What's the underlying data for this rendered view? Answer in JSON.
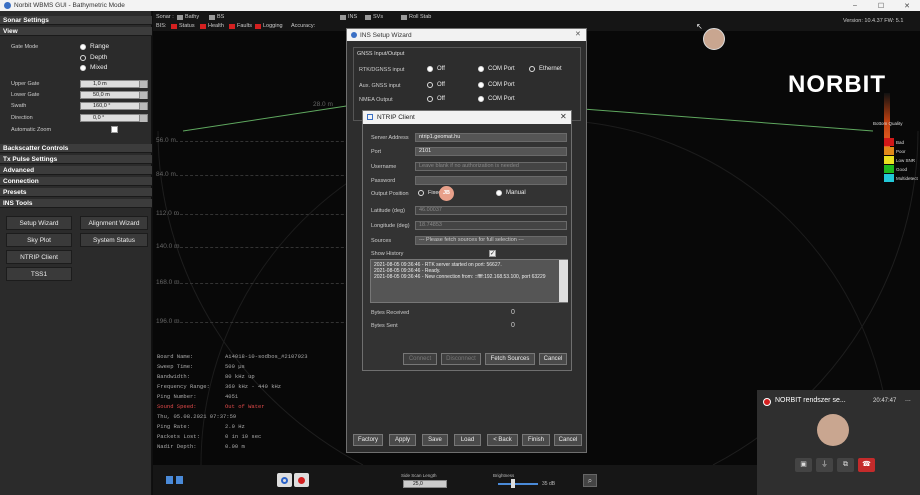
{
  "window": {
    "title": "Norbit WBMS GUI - Bathymetric Mode",
    "controls": [
      "–",
      "☐",
      "✕"
    ]
  },
  "sidebar": {
    "sections": {
      "sonar_settings": "Sonar Settings",
      "view": "View",
      "backscatter": "Backscatter Controls",
      "tx_pulse": "Tx Pulse Settings",
      "advanced": "Advanced",
      "connection": "Connection",
      "presets": "Presets",
      "ins_tools": "INS Tools"
    },
    "view": {
      "gate_mode_label": "Gate Mode",
      "gate_mode_options": [
        "Range",
        "Depth",
        "Mixed"
      ],
      "upper_gate_label": "Upper Gate",
      "upper_gate_value": "1,0 m",
      "lower_gate_label": "Lower Gate",
      "lower_gate_value": "50,0 m",
      "swath_label": "Swath",
      "swath_value": "160,0 °",
      "direction_label": "Direction",
      "direction_value": "0,0 °",
      "auto_zoom_label": "Automatic Zoom"
    },
    "ins_tools": {
      "setup_wizard": "Setup Wizard",
      "alignment_wizard": "Alignment Wizard",
      "sky_plot": "Sky Plot",
      "system_status": "System Status",
      "ntrip_client": "NTRIP Client",
      "tss1": "TSS1"
    }
  },
  "toolbar": {
    "sonar_label": "Sonar :",
    "bathy": "Bathy",
    "bs": "BS",
    "bis_label": "BIS:",
    "status": "Status",
    "health": "Health",
    "faults": "Faults",
    "logging": "Logging",
    "accuracy": "Accuracy:",
    "ins": "INS",
    "svs": "SVs",
    "roll_stab": "Roll Stab",
    "version": "Version: 10.4.37  FW: 5.1",
    "status_colors": {
      "red": "#d42020",
      "gray": "#9a9a9a"
    }
  },
  "main": {
    "depth_labels": [
      "56.0 m",
      "84.0 m",
      "112.0 m",
      "140.0 m",
      "168.0 m",
      "196.0 m"
    ],
    "marker_label": "28.0 m",
    "brand": "NORBIT",
    "legend_title": "Bottom Quality",
    "legend": [
      {
        "label": "Bad",
        "color": "#d01818"
      },
      {
        "label": "Poor",
        "color": "#e08a1a"
      },
      {
        "label": "Low SNR",
        "color": "#e8e020"
      },
      {
        "label": "Good",
        "color": "#1fb81f"
      },
      {
        "label": "Multidetect",
        "color": "#22c8d8"
      }
    ],
    "info": [
      {
        "k": "Board Name:",
        "v": "Ai4018-10-sodbos_#2107023",
        "color": "#aaaaaa"
      },
      {
        "k": "Sweep Time:",
        "v": "500 µs",
        "color": "#aaaaaa"
      },
      {
        "k": "Bandwidth:",
        "v": "80 kHz up",
        "color": "#aaaaaa"
      },
      {
        "k": "Frequency Range:",
        "v": "360 kHz - 440 kHz",
        "color": "#aaaaaa"
      },
      {
        "k": "Ping Number:",
        "v": "4051",
        "color": "#aaaaaa"
      },
      {
        "k": "Sound Speed:",
        "v": "Out of Water",
        "color": "#e34a4a"
      },
      {
        "k": "Thu, 05.08.2021 07:37:59",
        "v": "",
        "color": "#aaaaaa"
      },
      {
        "k": "Ping Rate:",
        "v": "2.0 Hz",
        "color": "#aaaaaa"
      },
      {
        "k": "Packets Lost:",
        "v": "0 in 10 sec",
        "color": "#aaaaaa"
      },
      {
        "k": "Nadir Depth:",
        "v": "0.00 m",
        "color": "#aaaaaa"
      }
    ]
  },
  "bottombar": {
    "side_scan_label": "Side Scan Length",
    "side_scan_value": "25,0",
    "brightness_label": "Brightness",
    "brightness_value": "35 dB"
  },
  "ins_wizard": {
    "title": "INS Setup Wizard",
    "group": "GNSS Input/Output",
    "rtk_label": "RTK/DGNSS input",
    "aux_label": "Aux. GNSS input",
    "nmea_label": "NMEA Output",
    "off": "Off",
    "com_port": "COM Port",
    "ethernet": "Ethernet",
    "buttons": {
      "factory": "Factory",
      "apply": "Apply",
      "save": "Save",
      "load": "Load",
      "back": "< Back",
      "finish": "Finish",
      "cancel": "Cancel"
    }
  },
  "ntrip": {
    "title": "NTRIP Client",
    "server_address_label": "Server Address",
    "server_address": "ntrip1.geomat.hu",
    "port_label": "Port",
    "port": "2101",
    "username_label": "Username",
    "username_placeholder": "Leave blank if no authorization is needed",
    "password_label": "Password",
    "output_position_label": "Output Position",
    "fixed": "Fixed",
    "manual": "Manual",
    "latitude_label": "Latitude (deg)",
    "latitude": "46.00037",
    "longitude_label": "Longitude (deg)",
    "longitude": "18.74853",
    "sources_label": "Sources",
    "sources_placeholder": "--- Please fetch sources for full selection ---",
    "show_history_label": "Show History",
    "history": [
      "2021-08-05 09:36:46 - RTK server started on port: 56627.",
      "2021-08-05 09:36:46 - Ready.",
      "2021-08-05 09:36:46 - New connection from: ::ffff:192.168.53.100, port 63229"
    ],
    "bytes_received_label": "Bytes Received",
    "bytes_received": "0",
    "bytes_sent_label": "Bytes Sent",
    "bytes_sent": "0",
    "connect": "Connect",
    "disconnect": "Disconnect",
    "fetch_sources": "Fetch Sources",
    "cancel": "Cancel",
    "cursor_badge": "JB"
  },
  "call": {
    "title": "NORBIT rendszer se...",
    "time": "20:47:47",
    "more": "..."
  }
}
